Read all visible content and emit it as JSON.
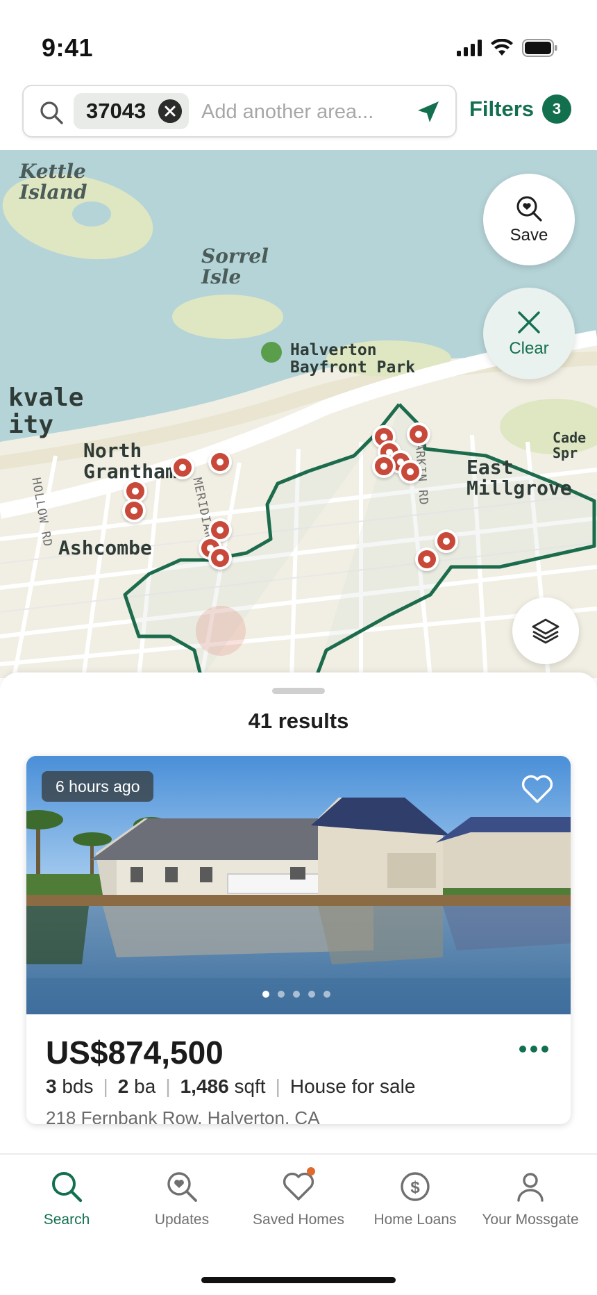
{
  "status_bar": {
    "time": "9:41"
  },
  "search": {
    "chip_label": "37043",
    "placeholder": "Add another area...",
    "filters_label": "Filters",
    "filters_count": "3"
  },
  "map": {
    "labels": {
      "kettle_island": "Kettle\nIsland",
      "sorrel_isle": "Sorrel\nIsle",
      "park": "Halverton\nBayfront Park",
      "kvale": "kvale\nity",
      "north_grantham": "North\nGrantham",
      "east_millgrove": "East\nMillgrove",
      "ashcombe": "Ashcombe",
      "cade": "Cade\nSpr",
      "meridian_rd": "MERIDIAN RD",
      "larkin_rd": "LARKIN RD",
      "hollow_rd": "HOLLOW RD"
    },
    "save_label": "Save",
    "clear_label": "Clear",
    "colors": {
      "boundary": "#1b6b4c",
      "pin": "#c8493a",
      "water": "#b5d4d8",
      "land": "#f1efe3",
      "park": "#dfe6c2"
    }
  },
  "results": {
    "count_label": "41 results",
    "listing": {
      "time_badge": "6 hours ago",
      "price": "US$874,500",
      "beds_value": "3",
      "beds_unit": "bds",
      "baths_value": "2",
      "baths_unit": "ba",
      "sqft_value": "1,486",
      "sqft_unit": "sqft",
      "type": "House for sale",
      "address": "218 Fernbank Row, Halverton, CA",
      "photo_index": 1,
      "photo_count": 5
    }
  },
  "tabs": [
    {
      "label": "Search",
      "icon": "search-icon",
      "active": true
    },
    {
      "label": "Updates",
      "icon": "updates-icon",
      "active": false
    },
    {
      "label": "Saved Homes",
      "icon": "heart-icon",
      "active": false
    },
    {
      "label": "Home Loans",
      "icon": "dollar-icon",
      "active": false
    },
    {
      "label": "Your Mossgate",
      "icon": "user-icon",
      "active": false
    }
  ]
}
